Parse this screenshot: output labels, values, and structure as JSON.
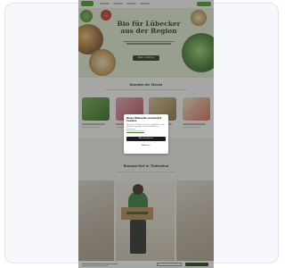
{
  "hero": {
    "title": "Bio für Lübecker aus der Region",
    "cta_label": "Mehr erfahren"
  },
  "section_recipes": {
    "title": "Rezepte der Woche"
  },
  "section_story": {
    "title": "Bioland-Hof in Tiefenthal"
  },
  "modal": {
    "title": "Diese Webseite verwendet Cookies",
    "body": "Wir nutzen Cookies, um unsere Webseite für Sie optimal zu gestalten und fortlaufend zu verbessern.",
    "link": "Datenschutzerklärung",
    "accept_label": "Alle akzeptieren",
    "decline_label": "Ablehnen"
  },
  "colors": {
    "brand_green": "#4a9d2e",
    "dark_green": "#1d3b1c",
    "overlay": "rgba(60,60,55,0.45)"
  }
}
